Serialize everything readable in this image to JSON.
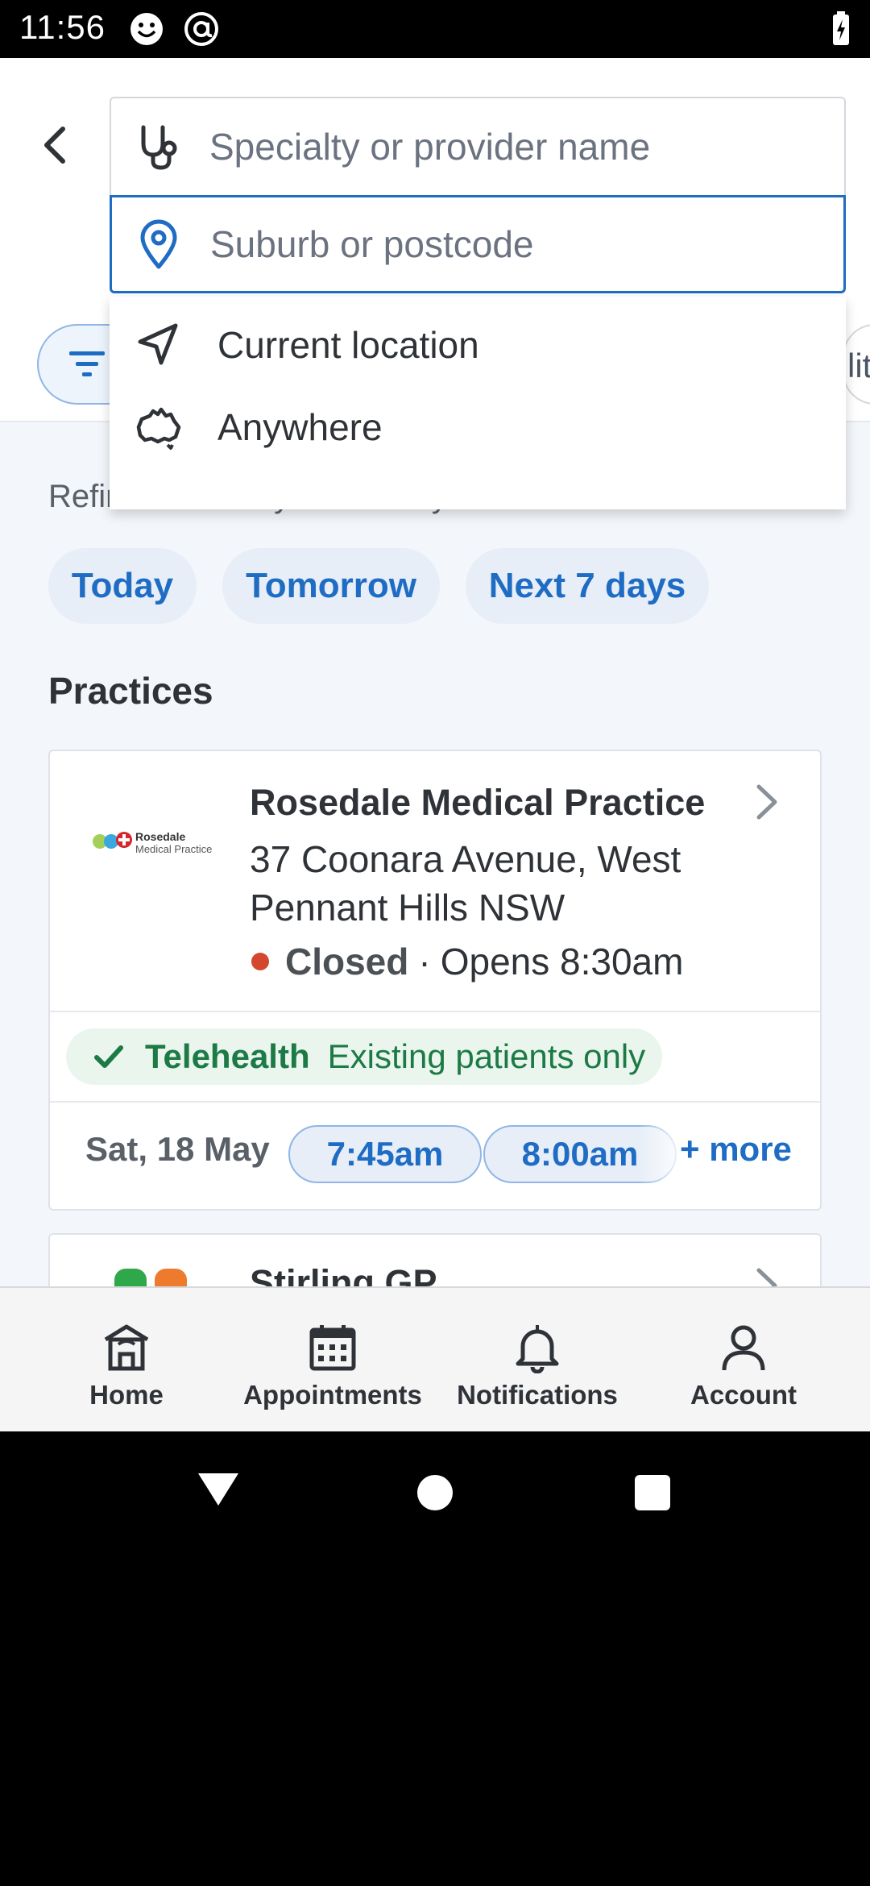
{
  "status_bar": {
    "time": "11:56"
  },
  "search": {
    "specialty_placeholder": "Specialty or provider name",
    "location_placeholder": "Suburb or postcode",
    "filter_clipped_text": "lit"
  },
  "location_dropdown": {
    "items": [
      {
        "label": "Current location",
        "icon": "navigation-arrow-icon"
      },
      {
        "label": "Anywhere",
        "icon": "australia-map-icon"
      }
    ]
  },
  "availability": {
    "label": "Refine search by availability",
    "chips": [
      "Today",
      "Tomorrow",
      "Next 7 days"
    ]
  },
  "practices": {
    "heading": "Practices",
    "cards": [
      {
        "name": "Rosedale Medical Practice",
        "logo_text_1": "Rosedale",
        "logo_text_2": "Medical Practice",
        "address": "37 Coonara Avenue, West Pennant Hills NSW",
        "status": "Closed",
        "separator": "·",
        "opens": "Opens 8:30am",
        "telehealth_label": "Telehealth",
        "telehealth_note": "Existing patients only",
        "slot_date": "Sat, 18 May",
        "slots": [
          "7:45am",
          "8:00am"
        ],
        "more_label": "+ more"
      },
      {
        "name": "Stirling GP"
      }
    ]
  },
  "bottom_nav": {
    "items": [
      {
        "label": "Home",
        "icon": "home-icon"
      },
      {
        "label": "Appointments",
        "icon": "calendar-icon"
      },
      {
        "label": "Notifications",
        "icon": "bell-icon"
      },
      {
        "label": "Account",
        "icon": "person-icon"
      }
    ]
  },
  "colors": {
    "accent_blue": "#1f6cc4",
    "telehealth_green": "#1c7a45",
    "closed_red": "#d3472e"
  }
}
